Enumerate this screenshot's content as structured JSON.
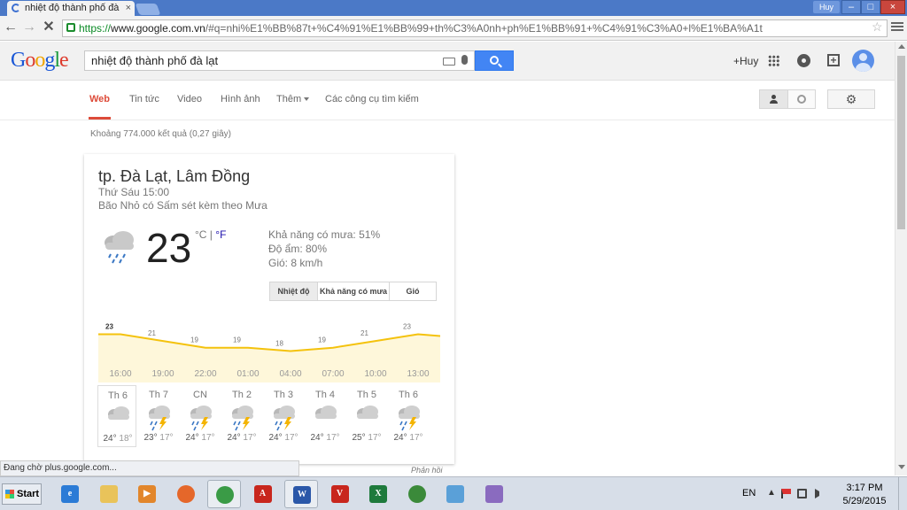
{
  "browser": {
    "tab_title": "nhiệt độ thành phố đà",
    "tab_close": "×",
    "user_badge": "Huy",
    "window_min": "–",
    "window_max": "□",
    "window_close": "×",
    "url_scheme": "https://",
    "url_host": "www.google.com.vn",
    "url_rest": "/#q=nhi%E1%BB%87t+%C4%91%E1%BB%99+th%C3%A0nh+ph%E1%BB%91+%C4%91%C3%A0+l%E1%BA%A1t",
    "back": "←",
    "forward": "→",
    "stop": "✕",
    "star": "☆",
    "status_text": "Đang chờ plus.google.com..."
  },
  "google": {
    "logo": [
      "G",
      "o",
      "o",
      "g",
      "l",
      "e"
    ],
    "query": "nhiệt độ thành phố đà lạt",
    "plus_user": "+Huy",
    "share_glyph": "+",
    "settings_glyph": "⚙",
    "tabs": [
      {
        "label": "Web",
        "active": true
      },
      {
        "label": "Tin tức"
      },
      {
        "label": "Video"
      },
      {
        "label": "Hình ảnh"
      },
      {
        "label": "Thêm"
      },
      {
        "label": "Các công cụ tìm kiếm"
      }
    ],
    "result_stats": "Khoảng 774.000 kết quả (0,27 giây)"
  },
  "weather": {
    "location": "tp. Đà Lạt, Lâm Đồng",
    "time": "Thứ Sáu 15:00",
    "condition": "Bão Nhỏ có Sấm sét kèm theo Mưa",
    "temp": "23",
    "unit_c": "°C",
    "unit_sep": " | ",
    "unit_f": "°F",
    "rain_chance": "Khả năng có mưa: 51%",
    "humidity": "Độ ẩm: 80%",
    "wind": "Gió: 8 km/h",
    "tab_temp": "Nhiệt độ",
    "tab_rain": "Khả năng có mưa",
    "tab_wind": "Gió",
    "feedback": "Phản hồi",
    "days": [
      {
        "name": "Th 6",
        "hi": "24°",
        "lo": "18°",
        "icon": "partly-cloudy-icon"
      },
      {
        "name": "Th 7",
        "hi": "23°",
        "lo": "17°",
        "icon": "thunderstorm-icon"
      },
      {
        "name": "CN",
        "hi": "24°",
        "lo": "17°",
        "icon": "thunderstorm-icon"
      },
      {
        "name": "Th 2",
        "hi": "24°",
        "lo": "17°",
        "icon": "thunderstorm-icon"
      },
      {
        "name": "Th 3",
        "hi": "24°",
        "lo": "17°",
        "icon": "thunderstorm-icon"
      },
      {
        "name": "Th 4",
        "hi": "24°",
        "lo": "17°",
        "icon": "partly-cloudy-icon"
      },
      {
        "name": "Th 5",
        "hi": "25°",
        "lo": "17°",
        "icon": "partly-cloudy-icon"
      },
      {
        "name": "Th 6",
        "hi": "24°",
        "lo": "17°",
        "icon": "thunderstorm-icon"
      }
    ],
    "colors": {
      "line": "#f4c20d",
      "fill": "#fef7da"
    }
  },
  "chart_data": {
    "type": "area",
    "x": [
      "16:00",
      "19:00",
      "22:00",
      "01:00",
      "04:00",
      "07:00",
      "10:00",
      "13:00"
    ],
    "labels": [
      "23",
      "21",
      "19",
      "19",
      "18",
      "19",
      "21",
      "23"
    ],
    "values": [
      23,
      21,
      19,
      19,
      18,
      19,
      21,
      23
    ]
  },
  "taskbar": {
    "start": "Start",
    "apps": [
      {
        "name": "ie-icon",
        "glyph": "e",
        "color": "#2b7bd6",
        "open": false
      },
      {
        "name": "explorer-icon",
        "glyph": "",
        "color": "#e9c35a",
        "open": false
      },
      {
        "name": "media-player-icon",
        "glyph": "▶",
        "color": "#e2862b",
        "open": false
      },
      {
        "name": "firefox-icon",
        "glyph": "",
        "color": "#e5672a",
        "open": false
      },
      {
        "name": "chrome-icon",
        "glyph": "",
        "color": "#3a9b46",
        "open": true
      },
      {
        "name": "acrobat-icon",
        "glyph": "A",
        "color": "#c8261d",
        "open": false
      },
      {
        "name": "word-icon",
        "glyph": "W",
        "color": "#2a57a8",
        "open": true
      },
      {
        "name": "unikey-icon",
        "glyph": "V",
        "color": "#c8261d",
        "open": false
      },
      {
        "name": "excel-icon",
        "glyph": "X",
        "color": "#1e7a3c",
        "open": false
      },
      {
        "name": "network-icon",
        "glyph": "",
        "color": "#3b8a3a",
        "open": false
      },
      {
        "name": "chat-icon",
        "glyph": "",
        "color": "#5aa0d8",
        "open": false
      },
      {
        "name": "paint-icon",
        "glyph": "",
        "color": "#8a6bbf",
        "open": false
      }
    ],
    "lang": "EN",
    "tray_arrow": "▲",
    "clock_time": "3:17 PM",
    "clock_date": "5/29/2015"
  }
}
